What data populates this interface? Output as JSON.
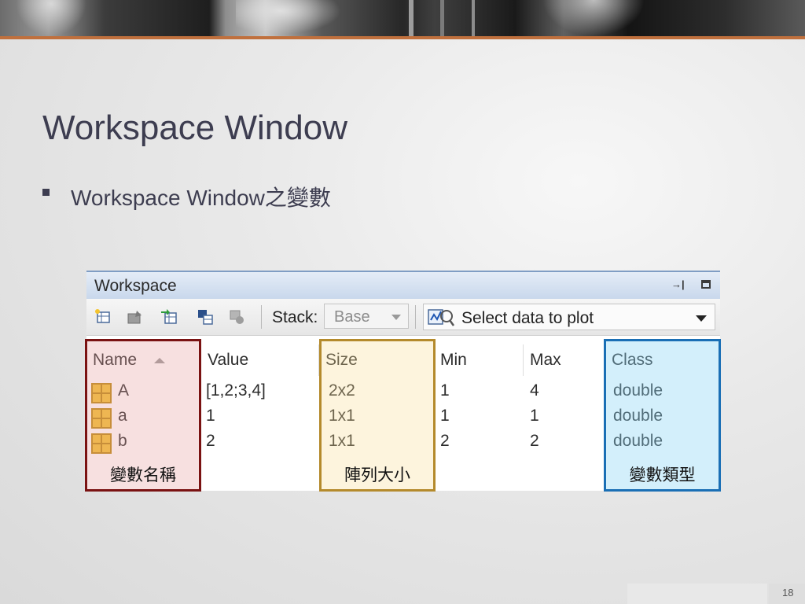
{
  "slide": {
    "title": "Workspace Window",
    "bullet": "Workspace Window之變數",
    "page_number": "18"
  },
  "workspace": {
    "title": "Workspace",
    "toolbar": {
      "stack_label": "Stack:",
      "stack_value": "Base",
      "plot_select_label": "Select data to plot"
    },
    "columns": [
      "Name",
      "Value",
      "Size",
      "Min",
      "Max",
      "Class"
    ],
    "sorted_column": "Name",
    "rows": [
      {
        "name": "A",
        "value": "[1,2;3,4]",
        "size": "2x2",
        "min": "1",
        "max": "4",
        "class": "double"
      },
      {
        "name": "a",
        "value": "1",
        "size": "1x1",
        "min": "1",
        "max": "1",
        "class": "double"
      },
      {
        "name": "b",
        "value": "2",
        "size": "1x1",
        "min": "2",
        "max": "2",
        "class": "double"
      }
    ]
  },
  "annotations": {
    "name": "變數名稱",
    "size": "陣列大小",
    "class": "變數類型"
  },
  "colors": {
    "accent_line": "#c0703d",
    "title_text": "#3d3d50",
    "name_box": "#7a1212",
    "size_box": "#b48a2c",
    "class_box": "#1a6fb5"
  }
}
